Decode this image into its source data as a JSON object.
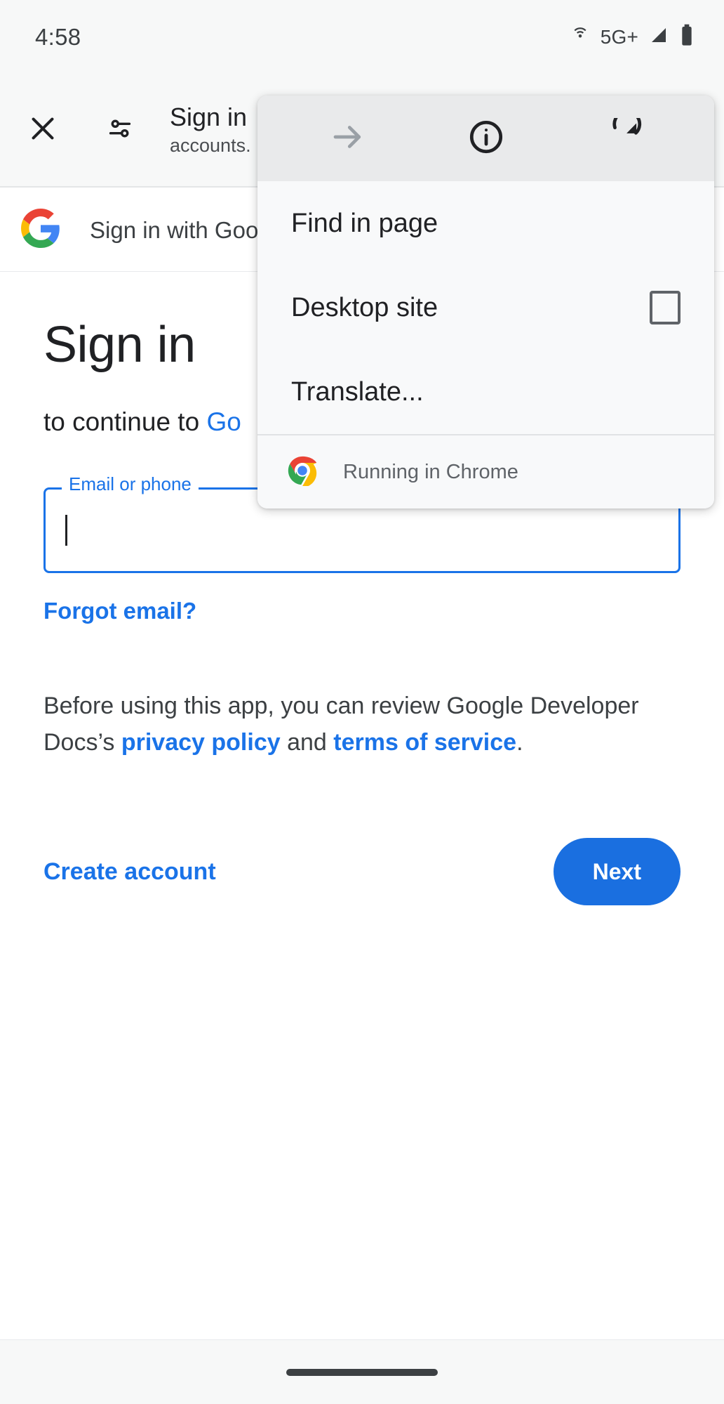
{
  "status_bar": {
    "time": "4:58",
    "network_label": "5G+",
    "icons": [
      "hotspot-icon",
      "cellular-signal-icon",
      "battery-icon"
    ]
  },
  "toolbar": {
    "close_label": "close-icon",
    "page_info_label": "page-info-icon",
    "title": "Sign in",
    "subtitle": "accounts."
  },
  "gsi_bar": {
    "label": "Sign in with Goo"
  },
  "content": {
    "heading": "Sign in",
    "subheading_prefix": "to continue to ",
    "subheading_target": "Go",
    "email_label": "Email or phone",
    "email_value": "",
    "forgot_email": "Forgot email?",
    "legal_prefix": "Before using this app, you can review Google Developer Docs’s ",
    "legal_privacy": "privacy policy",
    "legal_conjunction": " and ",
    "legal_terms": "terms of service",
    "legal_suffix": ".",
    "create_account": "Create account",
    "next_button": "Next"
  },
  "overflow_menu": {
    "icon_row": [
      {
        "name": "forward-arrow-icon",
        "state": "disabled"
      },
      {
        "name": "page-info-circle-icon",
        "state": "enabled"
      },
      {
        "name": "reload-icon",
        "state": "enabled"
      }
    ],
    "items": [
      {
        "label": "Find in page",
        "has_checkbox": false,
        "checked": false
      },
      {
        "label": "Desktop site",
        "has_checkbox": true,
        "checked": false
      },
      {
        "label": "Translate...",
        "has_checkbox": false,
        "checked": false
      }
    ],
    "footer": {
      "icon": "chrome-logo-icon",
      "label": "Running in Chrome"
    }
  },
  "bottom_nav": {
    "handle": "gesture-nav-handle"
  },
  "colors": {
    "accent_blue": "#1a73e8",
    "button_blue": "#1a6fe0",
    "status_bg": "#f7f8f8",
    "menu_bg": "#f8f9fa",
    "menu_header_bg": "#e9eaeb",
    "text_primary": "#202124",
    "text_secondary": "#5f6368"
  }
}
